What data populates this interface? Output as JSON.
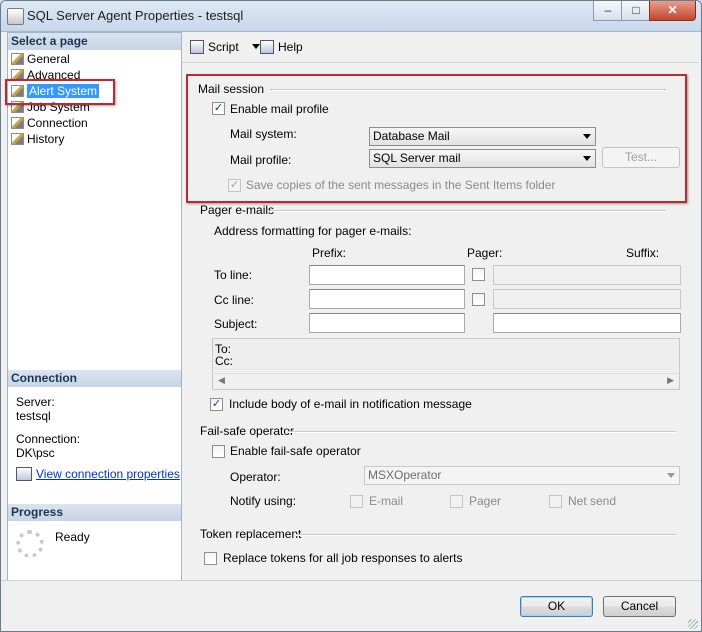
{
  "window": {
    "title": "SQL Server Agent Properties - testsql",
    "minimize": "–",
    "maximize": "□",
    "close": "✕"
  },
  "left": {
    "select_page": "Select a page",
    "pages": [
      {
        "label": "General",
        "icon": "page-icon"
      },
      {
        "label": "Advanced",
        "icon": "page-icon"
      },
      {
        "label": "Alert System",
        "icon": "page-icon",
        "selected": true
      },
      {
        "label": "Job System",
        "icon": "page-icon"
      },
      {
        "label": "Connection",
        "icon": "page-icon"
      },
      {
        "label": "History",
        "icon": "page-icon"
      }
    ],
    "connection_head": "Connection",
    "server_label": "Server:",
    "server_value": "testsql",
    "connection_label": "Connection:",
    "connection_value": "DK\\psc",
    "view_props_link": "View connection properties",
    "progress_head": "Progress",
    "progress_status": "Ready"
  },
  "toolbar": {
    "script": "Script",
    "help": "Help"
  },
  "mail_session": {
    "group": "Mail session",
    "enable_mail_profile": "Enable mail profile",
    "enable_checked": true,
    "mail_system_label": "Mail system:",
    "mail_system_value": "Database Mail",
    "mail_profile_label": "Mail profile:",
    "mail_profile_value": "SQL Server mail",
    "test_button": "Test...",
    "save_copies": "Save copies of the sent messages in the Sent Items folder",
    "save_copies_checked": true
  },
  "pager": {
    "group": "Pager e-mails",
    "address_format": "Address formatting for pager e-mails:",
    "col_prefix": "Prefix:",
    "col_pager": "Pager:",
    "col_suffix": "Suffix:",
    "to_line": "To line:",
    "cc_line": "Cc line:",
    "subject": "Subject:",
    "preview_to": "To:",
    "preview_cc": "Cc:",
    "include_body": "Include body of e-mail in notification message",
    "include_body_checked": true
  },
  "failsafe": {
    "group": "Fail-safe operator",
    "enable": "Enable fail-safe operator",
    "operator_label": "Operator:",
    "operator_value": "MSXOperator",
    "notify_using": "Notify using:",
    "email": "E-mail",
    "pager": "Pager",
    "net_send": "Net send"
  },
  "token": {
    "group": "Token replacement",
    "replace": "Replace tokens for all job responses to alerts"
  },
  "buttons": {
    "ok": "OK",
    "cancel": "Cancel"
  },
  "colors": {
    "highlight": "#3399ff",
    "annotation_red": "#c0282d",
    "link": "#0033cc"
  }
}
